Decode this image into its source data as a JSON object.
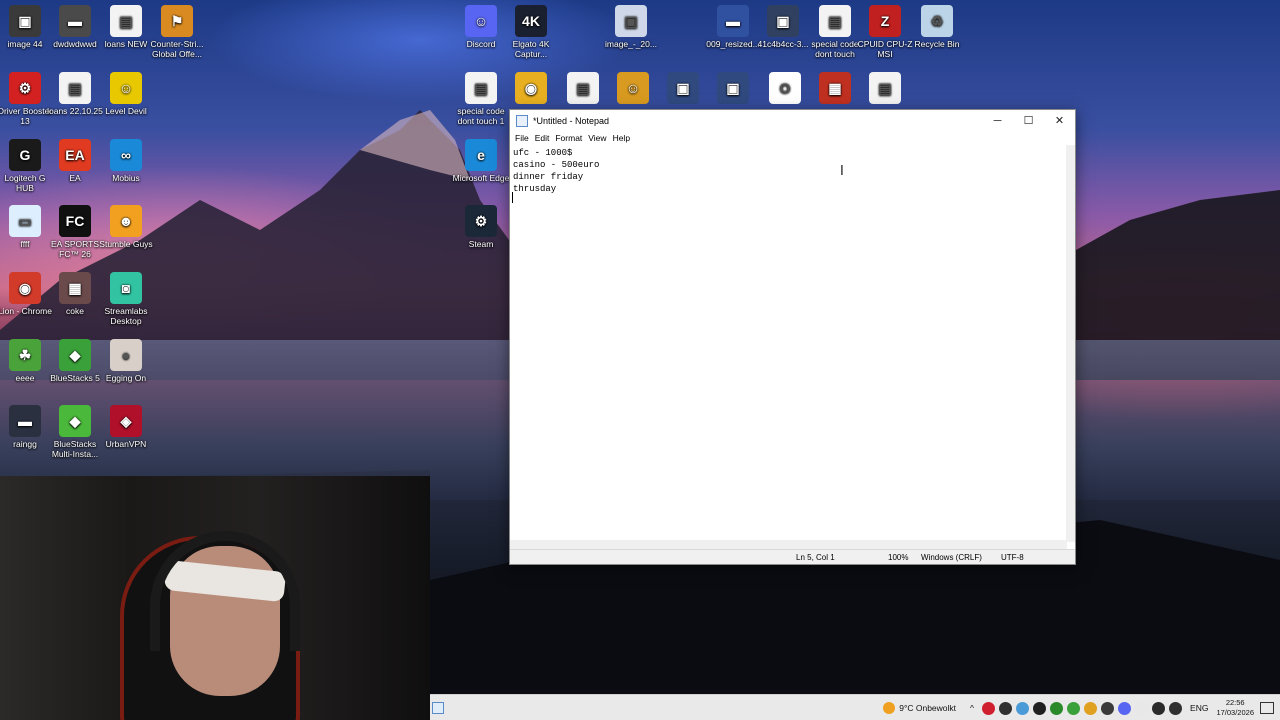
{
  "desktop": {
    "icons": [
      {
        "label": "image 44",
        "glyph": "▣",
        "color": "#3a3a3a"
      },
      {
        "label": "dwdwdwwd",
        "glyph": "▬",
        "color": "#4a4a4a"
      },
      {
        "label": "loans NEW",
        "glyph": "▤",
        "color": "#f3f3f3"
      },
      {
        "label": "Counter-Stri... Global Offe...",
        "glyph": "⚑",
        "color": "#d98a20"
      },
      {
        "label": "Driver Booster 13",
        "glyph": "⚙",
        "color": "#d32020"
      },
      {
        "label": "loans 22.10.25",
        "glyph": "▤",
        "color": "#f3f3f3"
      },
      {
        "label": "Level Devil",
        "glyph": "☺",
        "color": "#e8c800"
      },
      {
        "label": "Logitech G HUB",
        "glyph": "G",
        "color": "#1a1a1a"
      },
      {
        "label": "EA",
        "glyph": "EA",
        "color": "#e03a20"
      },
      {
        "label": "Mobius",
        "glyph": "∞",
        "color": "#1a8ad8"
      },
      {
        "label": "ffff",
        "glyph": "▭",
        "color": "#ddeeff"
      },
      {
        "label": "EA SPORTS FC™ 26",
        "glyph": "FC",
        "color": "#101010"
      },
      {
        "label": "Stumble Guys",
        "glyph": "☻",
        "color": "#f2a020"
      },
      {
        "label": "Lion - Chrome",
        "glyph": "◉",
        "color": "#d23a2a"
      },
      {
        "label": "coke",
        "glyph": "▦",
        "color": "#6a4a4a"
      },
      {
        "label": "Streamlabs Desktop",
        "glyph": "◙",
        "color": "#31c3a2"
      },
      {
        "label": "eeee",
        "glyph": "☘",
        "color": "#4aa33a"
      },
      {
        "label": "BlueStacks 5",
        "glyph": "◆",
        "color": "#3aa03a"
      },
      {
        "label": "Egging On",
        "glyph": "●",
        "color": "#d8d0c8"
      },
      {
        "label": "raingg",
        "glyph": "▬",
        "color": "#2a3040"
      },
      {
        "label": "BlueStacks Multi-Insta...",
        "glyph": "◆",
        "color": "#4ab83a"
      },
      {
        "label": "UrbanVPN",
        "glyph": "◈",
        "color": "#b0102a"
      },
      {
        "label": "Discord",
        "glyph": "☺",
        "color": "#5865f2"
      },
      {
        "label": "Elgato 4K Captur...",
        "glyph": "4K",
        "color": "#1a2030"
      },
      {
        "label": "image_-_20...",
        "glyph": "▣",
        "color": "#cfd8e8"
      },
      {
        "label": "009_resized...",
        "glyph": "▬",
        "color": "#3050a0"
      },
      {
        "label": "41c4b4cc-3...",
        "glyph": "▣",
        "color": "#304060"
      },
      {
        "label": "special code dont touch",
        "glyph": "▤",
        "color": "#f3f3f3"
      },
      {
        "label": "CPUID CPU-Z MSI",
        "glyph": "Z",
        "color": "#c02020"
      },
      {
        "label": "Recycle Bin",
        "glyph": "♻",
        "color": "#bcd4e8"
      },
      {
        "label": "special code dont touch 1",
        "glyph": "▤",
        "color": "#f3f3f3"
      },
      {
        "label": "",
        "glyph": "◉",
        "color": "#e8b020"
      },
      {
        "label": "",
        "glyph": "▤",
        "color": "#f3f3f3"
      },
      {
        "label": "",
        "glyph": "☺",
        "color": "#d89a20"
      },
      {
        "label": "",
        "glyph": "▣",
        "color": "#304a80"
      },
      {
        "label": "",
        "glyph": "▣",
        "color": "#304a80"
      },
      {
        "label": "",
        "glyph": "O",
        "color": "#ffffff"
      },
      {
        "label": "",
        "glyph": "▦",
        "color": "#c03020"
      },
      {
        "label": "",
        "glyph": "▤",
        "color": "#f3f3f3"
      },
      {
        "label": "Microsoft Edge",
        "glyph": "e",
        "color": "#1a8ad8"
      },
      {
        "label": "Steam",
        "glyph": "⚙",
        "color": "#1b2838"
      }
    ]
  },
  "notepad": {
    "title": "*Untitled - Notepad",
    "menu": [
      "File",
      "Edit",
      "Format",
      "View",
      "Help"
    ],
    "content": "ufc - 1000$\ncasino - 500euro\ndinner friday\nthrusday\n",
    "status": {
      "position": "Ln 5, Col 1",
      "zoom": "100%",
      "line_ending": "Windows (CRLF)",
      "encoding": "UTF-8"
    },
    "controls": {
      "minimize": "─",
      "maximize": "☐",
      "close": "✕"
    }
  },
  "taskbar": {
    "weather": "9°C  Onbewolkt",
    "language": "ENG",
    "time": "22:56",
    "date": "17/03/2026",
    "tray_colors": [
      "#d02030",
      "#303030",
      "#4a9ad8",
      "#202020",
      "#2a8a2a",
      "#3aa03a",
      "#e0a020",
      "#3a3a3a",
      "#5865f2",
      "#e8e8e8",
      "#2a2a2a",
      "#303030"
    ]
  }
}
